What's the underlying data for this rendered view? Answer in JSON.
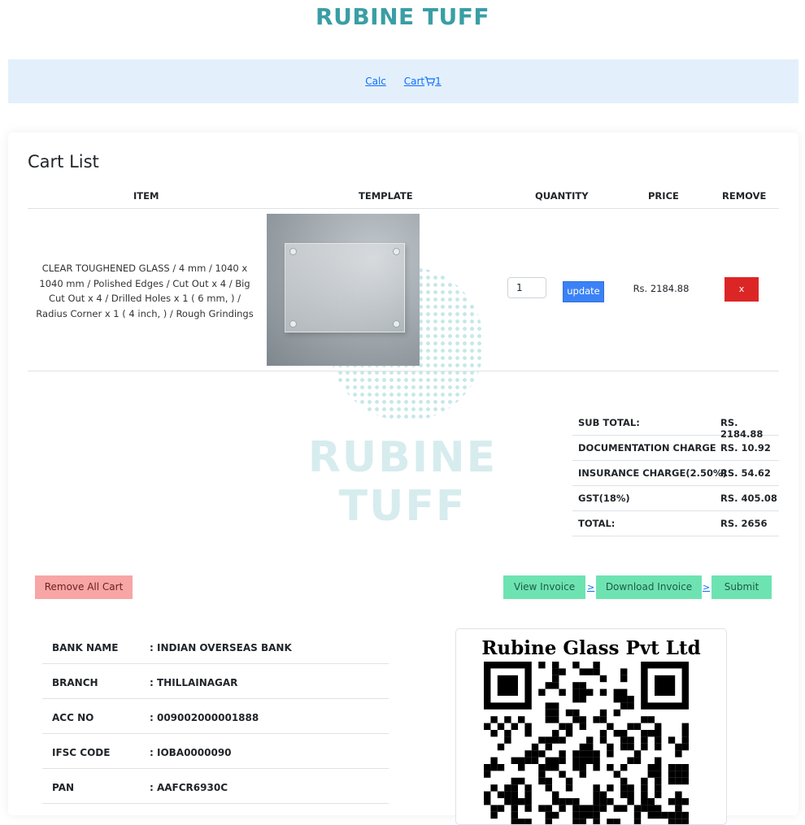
{
  "brand": {
    "title": "RUBINE TUFF",
    "color": "#3a9ea5"
  },
  "nav": {
    "calc": "Calc",
    "cart": "Cart",
    "cart_count": "1"
  },
  "cart": {
    "title": "Cart List",
    "columns": [
      "ITEM",
      "TEMPLATE",
      "QUANTITY",
      "PRICE",
      "REMOVE"
    ],
    "item": {
      "description": "CLEAR TOUGHENED GLASS / 4 mm / 1040 x 1040 mm / Polished Edges / Cut Out x 4 / Big Cut Out x 4 / Drilled Holes x 1 ( 6 mm, ) / Radius Corner x 1 ( 4 inch, ) / Rough Grindings",
      "quantity": "1",
      "update_label": "update",
      "price": "Rs. 2184.88",
      "remove_label": "x"
    },
    "watermark": "RUBINE TUFF"
  },
  "summary": [
    {
      "label": "SUB TOTAL:",
      "value": "RS. 2184.88"
    },
    {
      "label": "DOCUMENTATION CHARGE",
      "value": "RS. 10.92"
    },
    {
      "label": "INSURANCE CHARGE(2.50%)",
      "value": "RS. 54.62"
    },
    {
      "label": "GST(18%)",
      "value": "RS. 405.08"
    },
    {
      "label": "TOTAL:",
      "value": "RS. 2656"
    }
  ],
  "actions": {
    "remove_all": "Remove All Cart",
    "view_invoice": "View Invoice",
    "download_invoice": "Download Invoice",
    "submit": "Submit",
    "separator": ">"
  },
  "bank": [
    {
      "key": "BANK NAME",
      "value": ": INDIAN OVERSEAS BANK"
    },
    {
      "key": "BRANCH",
      "value": ": THILLAINAGAR"
    },
    {
      "key": "ACC NO",
      "value": ": 009002000001888"
    },
    {
      "key": "IFSC CODE",
      "value": ": IOBA0000090"
    },
    {
      "key": "PAN",
      "value": ": AAFCR6930C"
    }
  ],
  "qr": {
    "title": "Rubine Glass Pvt Ltd"
  }
}
